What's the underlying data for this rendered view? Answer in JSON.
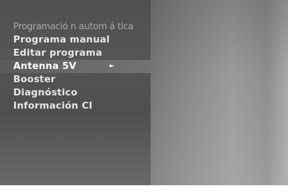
{
  "menu": {
    "items": [
      {
        "label": "Programació n autom á tica"
      },
      {
        "label": "Programa manual"
      },
      {
        "label": "Editar programa"
      },
      {
        "label": "Antenna 5V"
      },
      {
        "label": "Booster"
      },
      {
        "label": "Diagnóstico"
      },
      {
        "label": "Información CI"
      }
    ],
    "selected_index": 3,
    "submenu_arrow": "►"
  },
  "colors": {
    "menu_background": "#505050",
    "text": "#e6e6e6",
    "dim_text": "#a9a9a9",
    "selected_background": "#6a6a6a"
  }
}
